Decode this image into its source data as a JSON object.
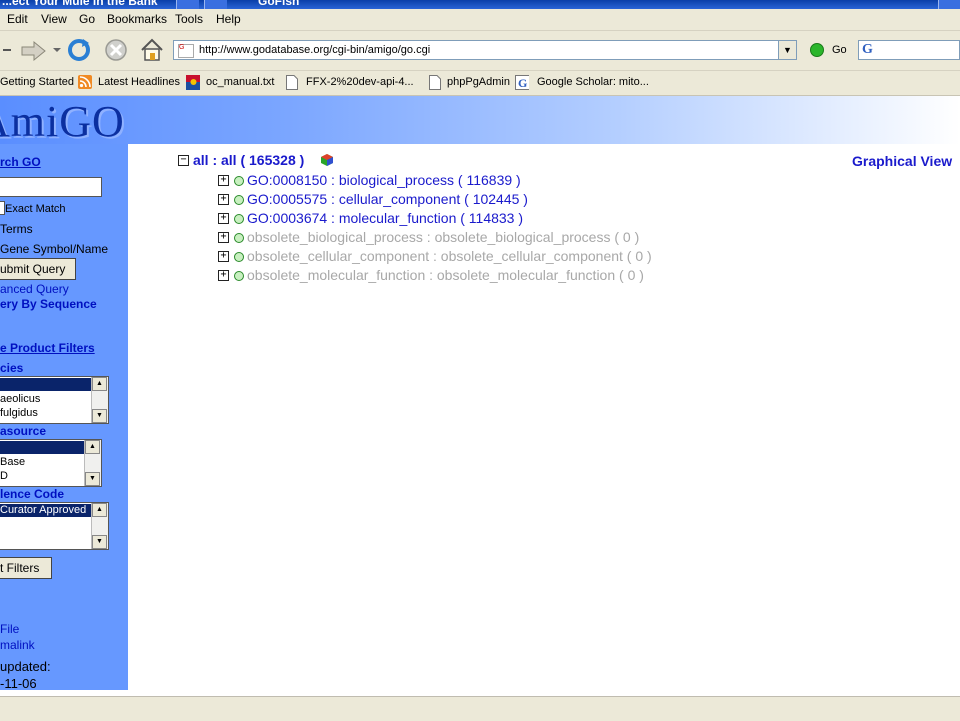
{
  "window": {
    "title_fragment": "...ect Your Mule in the Bank",
    "title_fragment_2": "GoFish"
  },
  "menu": {
    "items": [
      "Edit",
      "View",
      "Go",
      "Bookmarks",
      "Tools",
      "Help"
    ]
  },
  "address_bar": {
    "url": "http://www.godatabase.org/cgi-bin/amigo/go.cgi",
    "go_label": "Go",
    "search_engine_glyph": "G"
  },
  "bookmarks": [
    {
      "label": "Getting Started",
      "icon": "none"
    },
    {
      "label": "Latest Headlines",
      "icon": "rss-icon"
    },
    {
      "label": "oc_manual.txt",
      "icon": "flag-icon"
    },
    {
      "label": "FFX-2%20dev-api-4...",
      "icon": "page-icon"
    },
    {
      "label": "phpPgAdmin",
      "icon": "page-icon"
    },
    {
      "label": "Google Scholar: mito...",
      "icon": "google-icon"
    }
  ],
  "amigo": {
    "logo": "AmiGO",
    "sidebar": {
      "search_heading": "rch GO",
      "exact_match": "Exact Match",
      "terms": "Terms",
      "gene_symbol": "Gene Symbol/Name",
      "submit": "ubmit Query",
      "advanced_query": "anced Query",
      "query_by_sequence": "ery By Sequence",
      "product_filters": "e Product Filters",
      "species_heading": "cies",
      "species_options": [
        "",
        "aeolicus",
        "fulgidus"
      ],
      "datasource_heading": "asource",
      "datasource_options": [
        "",
        "Base",
        "D"
      ],
      "evidence_heading": "lence Code",
      "evidence_options": [
        "Curator Approved"
      ],
      "set_filters": "t Filters",
      "file": "File",
      "permalink": "malink",
      "updated_label": "updated:",
      "updated_date": "-11-06"
    },
    "graphical_view": "Graphical View",
    "tree": {
      "root": "all : all ( 165328 )",
      "children": [
        {
          "label": "GO:0008150 : biological_process ( 116839 )",
          "obsolete": false
        },
        {
          "label": "GO:0005575 : cellular_component ( 102445 )",
          "obsolete": false
        },
        {
          "label": "GO:0003674 : molecular_function ( 114833 )",
          "obsolete": false
        },
        {
          "label": "obsolete_biological_process : obsolete_biological_process ( 0 )",
          "obsolete": true
        },
        {
          "label": "obsolete_cellular_component : obsolete_cellular_component ( 0 )",
          "obsolete": true
        },
        {
          "label": "obsolete_molecular_function : obsolete_molecular_function ( 0 )",
          "obsolete": true
        }
      ]
    }
  },
  "colors": {
    "sidebar_bg": "#6698ff",
    "link": "#1a1acc",
    "obsolete": "#a8a8a8",
    "logo": "#0b2fa0"
  }
}
